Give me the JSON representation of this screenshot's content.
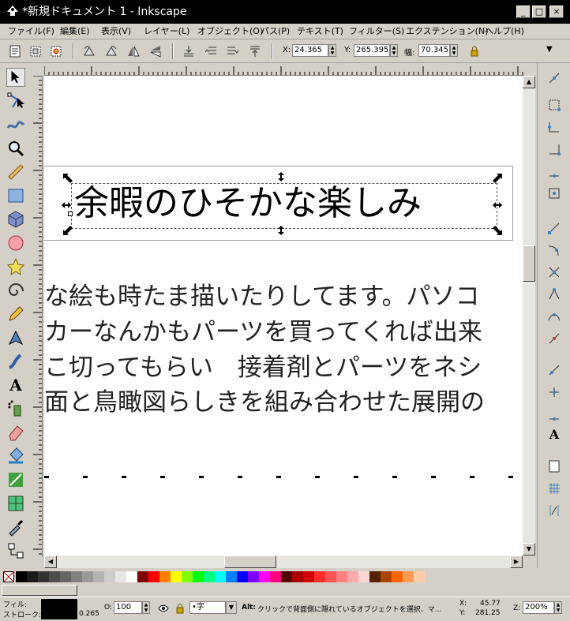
{
  "window": {
    "title": "*新規ドキュメント 1 - Inkscape",
    "buttons": [
      "_",
      "□",
      "×"
    ]
  },
  "menu": [
    "ファイル(F)",
    "編集(E)",
    "表示(V)",
    "レイヤー(L)",
    "オブジェクト(O)",
    "パス(P)",
    "テキスト(T)",
    "フィルター(S)",
    "エクステンション(N)",
    "ヘルプ(H)"
  ],
  "controls": {
    "x_label": "X:",
    "x_value": "24.365",
    "y_label": "Y:",
    "y_value": "265.395",
    "w_label": "幅:",
    "w_value": "70.345"
  },
  "canvas": {
    "title": "余暇のひそかな楽しみ",
    "lines": [
      "な絵も時たま描いたりしてます。パソコ",
      "カーなんかもパーツを買ってくれば出来",
      "こ切ってもらい　接着剤とパーツをネシ",
      "面と鳥瞰図らしきを組み合わせた展開の"
    ]
  },
  "status": {
    "fill_label": "フィル:",
    "stroke_label": "ストローク:",
    "stroke_width": "0.265",
    "opacity_label": "O:",
    "opacity_value": "100",
    "layer_value": "•字",
    "alt_label": "Alt:",
    "message": "クリックで背面側に隠れているオブジェクトを選択、マ...",
    "x_label": "X:",
    "x_coord": "45.77",
    "y_label": "Y:",
    "y_coord": "281.25",
    "zoom_label": "Z:",
    "zoom_value": "200%"
  },
  "palette_colors": [
    "#000000",
    "#1a1a1a",
    "#333333",
    "#4d4d4d",
    "#666666",
    "#808080",
    "#999999",
    "#b3b3b3",
    "#cccccc",
    "#e6e6e6",
    "#ffffff",
    "#800000",
    "#ff0000",
    "#ff8000",
    "#ffff00",
    "#80ff00",
    "#00ff00",
    "#00ff80",
    "#00ffff",
    "#0080ff",
    "#0000ff",
    "#8000ff",
    "#ff00ff",
    "#ff0080",
    "#550000",
    "#aa0000",
    "#d40000",
    "#ff2a2a",
    "#ff5555",
    "#ff8080",
    "#ffaaaa",
    "#ffd5d5",
    "#552200",
    "#aa4400",
    "#ff6600",
    "#ff9955",
    "#ffccaa"
  ]
}
